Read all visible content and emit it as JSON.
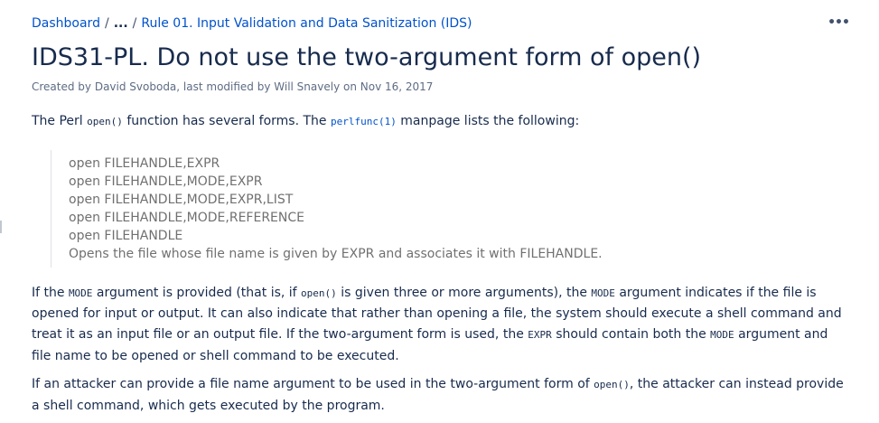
{
  "breadcrumb": {
    "root": "Dashboard",
    "sep": "/",
    "ellipsis": "...",
    "parent": "Rule 01. Input Validation and Data Sanitization (IDS)"
  },
  "actions": {
    "more": "•••"
  },
  "page": {
    "title": "IDS31-PL. Do not use the two-argument form of open()",
    "byline": "Created by David Svoboda, last modified by Will Snavely on Nov 16, 2017"
  },
  "body": {
    "p1": {
      "t1": "The Perl ",
      "c1": "open()",
      "t2": " function has several forms. The ",
      "c2": "perlfunc(1)",
      "t3": " manpage lists the following:"
    },
    "quote_lines": [
      "open FILEHANDLE,EXPR",
      "open FILEHANDLE,MODE,EXPR",
      "open FILEHANDLE,MODE,EXPR,LIST",
      "open FILEHANDLE,MODE,REFERENCE",
      "open FILEHANDLE",
      "Opens the file whose file name is given by EXPR and associates it with FILEHANDLE."
    ],
    "p2": {
      "t1": "If the ",
      "c1": "MODE",
      "t2": " argument is provided (that is, if ",
      "c2": "open()",
      "t3": " is given three or more arguments), the ",
      "c3": "MODE",
      "t4": " argument indicates if the file is opened for input or output. It can also indicate that rather than opening a file, the system should execute a shell command and treat it as an input file or an output file. If the two-argument form is used, the ",
      "c4": "EXPR",
      "t5": " should contain both the ",
      "c5": "MODE",
      "t6": " argument and file name to be opened or shell command to be executed."
    },
    "p3": {
      "t1": "If an attacker can provide a file name argument to be used in the two-argument form of ",
      "c1": "open()",
      "t2": ", the attacker can instead provide a shell command, which gets executed by the program."
    }
  }
}
